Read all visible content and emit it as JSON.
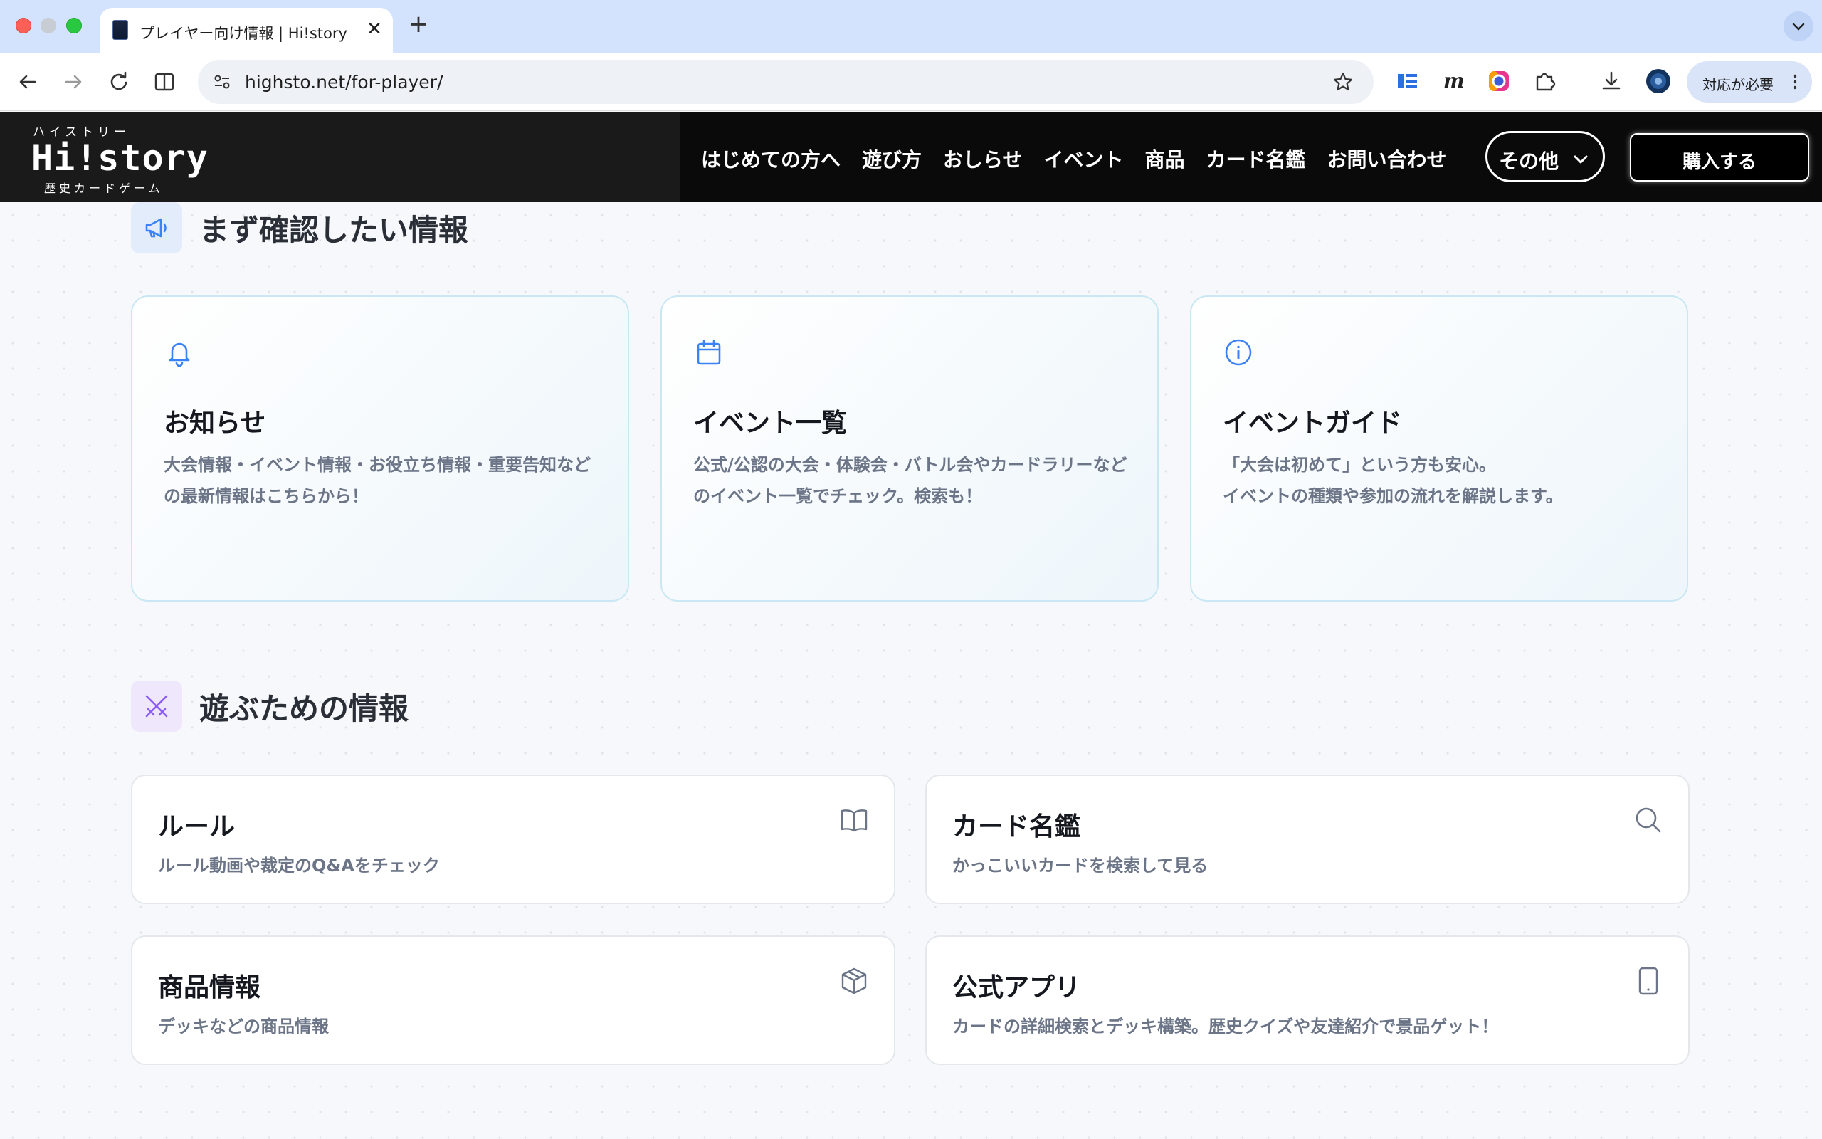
{
  "browser": {
    "tab_title": "プレイヤー向け情報 | Hi!story [",
    "tab_close": "✕",
    "new_tab": "+",
    "url": "highsto.net/for-player/",
    "profile_label": "対応が必要"
  },
  "header": {
    "logo_kana": "ハイストリー",
    "logo_main": "Hi!story",
    "logo_sub": "歴史カードゲーム",
    "nav": [
      "はじめての方へ",
      "遊び方",
      "おしらせ",
      "イベント",
      "商品",
      "カード名鑑",
      "お問い合わせ"
    ],
    "other_label": "その他",
    "buy_label": "購入する"
  },
  "section1": {
    "title": "まず確認したい情報",
    "cards": [
      {
        "icon": "bell-icon",
        "title": "お知らせ",
        "desc": "大会情報・イベント情報・お役立ち情報・重要告知などの最新情報はこちらから！"
      },
      {
        "icon": "calendar-icon",
        "title": "イベント一覧",
        "desc": "公式/公認の大会・体験会・バトル会やカードラリーなどのイベント一覧でチェック。検索も！"
      },
      {
        "icon": "info-icon",
        "title": "イベントガイド",
        "desc": "「大会は初めて」という方も安心。\nイベントの種類や参加の流れを解説します。"
      }
    ]
  },
  "section2": {
    "title": "遊ぶための情報",
    "tiles": [
      {
        "icon": "book-icon",
        "title": "ルール",
        "desc": "ルール動画や裁定のQ&Aをチェック"
      },
      {
        "icon": "search-icon",
        "title": "カード名鑑",
        "desc": "かっこいいカードを検索して見る"
      },
      {
        "icon": "box-icon",
        "title": "商品情報",
        "desc": "デッキなどの商品情報"
      },
      {
        "icon": "smartphone-icon",
        "title": "公式アプリ",
        "desc": "カードの詳細検索とデッキ構築。歴史クイズや友達紹介で景品ゲット！"
      }
    ]
  },
  "colors": {
    "header_bg": "#0a0a0a",
    "card_border": "#c9e8f3",
    "icon_blue": "#3b82f6",
    "icon_purple": "#8b5cf6",
    "desc_gray": "#6b7587"
  }
}
